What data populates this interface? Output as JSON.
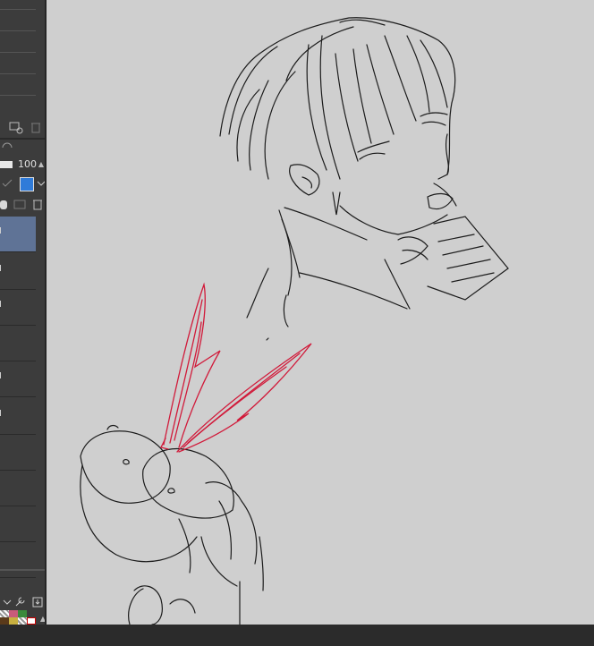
{
  "layer_panel": {
    "opacity": "100",
    "layer_count": 10,
    "selected_index": 0
  },
  "colors": {
    "canvas_bg": "#cfcfcf",
    "panel_bg": "#3c3c3c",
    "selected_layer": "#5f7396",
    "sketch_red": "#d11a3a",
    "sketch_black": "#1c1c1c"
  },
  "icons": {
    "new_layer": "new-layer-icon",
    "delete": "trash-icon",
    "mask": "mask-icon",
    "tool_property": "wrench-icon",
    "export": "export-icon"
  }
}
